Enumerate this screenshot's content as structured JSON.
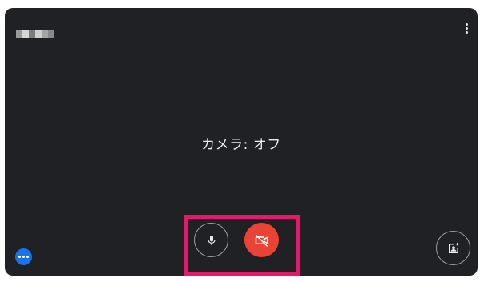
{
  "tile": {
    "status_text": "カメラ: オフ",
    "background_color": "#202124"
  },
  "participant_name": {
    "blurred": true
  },
  "controls": {
    "more_options_icon": "vertical-dots-icon",
    "chat_bubble_icon": "horizontal-dots-icon",
    "mic_icon": "microphone-icon",
    "camera_icon": "video-camera-off-icon",
    "effects_icon": "portrait-sparkle-icon",
    "camera_button_color": "#ea4335",
    "bubble_color": "#1a73e8"
  },
  "annotation": {
    "highlight_color": "#e8176b"
  }
}
